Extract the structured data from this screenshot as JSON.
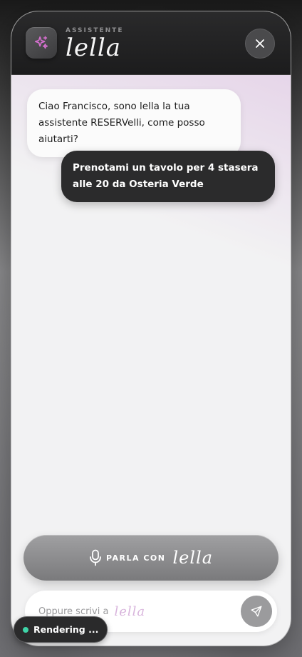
{
  "header": {
    "subtitle": "ASSISTENTE",
    "brand": "lella",
    "logo_icon": "sparkles-icon",
    "close_icon": "close-icon"
  },
  "messages": [
    {
      "role": "assistant",
      "text": "Ciao Francisco, sono lella la tua assistente RESERVelli, come posso aiutarti?"
    },
    {
      "role": "user",
      "text": "Prenotami un tavolo per 4 stasera alle 20 da Osteria Verde"
    }
  ],
  "voice_button": {
    "icon": "microphone-icon",
    "label": "PARLA CON",
    "brand": "lella"
  },
  "input": {
    "placeholder": "Oppure scrivi a",
    "placeholder_brand": "lella",
    "send_icon": "send-icon"
  },
  "status": {
    "text": "Rendering ...",
    "dot_color": "#3fd4a8"
  },
  "colors": {
    "accent": "#d46fce",
    "brand_light": "#d8b4dc"
  }
}
